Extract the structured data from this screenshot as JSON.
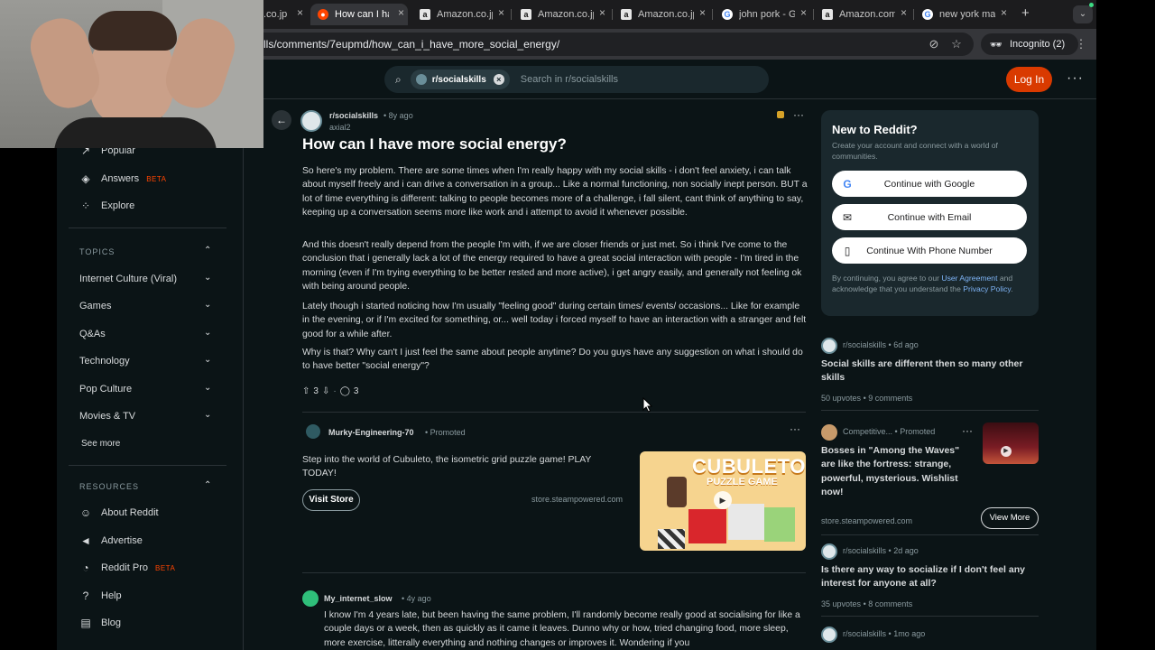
{
  "tabs": [
    {
      "title": ".co.jp",
      "favicon": "amazon",
      "active": false
    },
    {
      "title": "How can I ha",
      "favicon": "reddit",
      "active": true
    },
    {
      "title": "Amazon.co.jp",
      "favicon": "amazon",
      "active": false
    },
    {
      "title": "Amazon.co.jp",
      "favicon": "amazon",
      "active": false
    },
    {
      "title": "Amazon.co.jp",
      "favicon": "amazon",
      "active": false
    },
    {
      "title": "john pork - G",
      "favicon": "google",
      "active": false
    },
    {
      "title": "Amazon.com",
      "favicon": "amazon",
      "active": false
    },
    {
      "title": "new york ma",
      "favicon": "google",
      "active": false
    }
  ],
  "tab_close_glyph": "×",
  "new_tab_glyph": "+",
  "url": "lls/comments/7eupmd/how_can_i_have_more_social_energy/",
  "incognito_label": "Incognito (2)",
  "header": {
    "subreddit_chip": "r/socialskills",
    "search_placeholder": "Search in r/socialskills",
    "login_label": "Log In"
  },
  "sidebar": {
    "items_top": [
      {
        "label": "Popular",
        "icon": "trending-icon"
      },
      {
        "label": "Answers",
        "icon": "answers-icon",
        "badge": "BETA"
      },
      {
        "label": "Explore",
        "icon": "explore-icon"
      }
    ],
    "topics_heading": "TOPICS",
    "topics": [
      "Internet Culture (Viral)",
      "Games",
      "Q&As",
      "Technology",
      "Pop Culture",
      "Movies & TV"
    ],
    "see_more": "See more",
    "resources_heading": "RESOURCES",
    "resources": [
      {
        "label": "About Reddit",
        "icon": "reddit-alien-icon"
      },
      {
        "label": "Advertise",
        "icon": "megaphone-icon"
      },
      {
        "label": "Reddit Pro",
        "icon": "pro-icon",
        "badge": "BETA"
      },
      {
        "label": "Help",
        "icon": "help-icon"
      },
      {
        "label": "Blog",
        "icon": "book-icon"
      }
    ]
  },
  "post": {
    "subreddit": "r/socialskills",
    "age": "8y ago",
    "author": "axial2",
    "title": "How can I have more social energy?",
    "paragraphs": [
      "So here's my problem. There are some times when I'm really happy with my social skills - i don't feel anxiety, i can talk about myself freely and i can drive a conversation in a group... Like a normal functioning, non socially inept person. BUT a lot of time everything is different: talking to people becomes more of a challenge, i fall silent, cant think of anything to say, keeping up a conversation seems more like work and i attempt to avoid it whenever possible.",
      "And this doesn't really depend from the people I'm with, if we are closer friends or just met. So i think I've come to the conclusion that i generally lack a lot of the energy required to have a great social interaction with people - I'm tired in the morning (even if I'm trying everything to be better rested and more active), i get angry easily, and generally not feeling ok with being around people.",
      "Lately though i started noticing how I'm usually \"feeling good\" during certain times/ events/ occasions... Like for example in the evening, or if I'm excited for something, or... well today i forced myself to have an interaction with a stranger and felt good for a while after.",
      "Why is that? Why can't I just feel the same about people anytime? Do you guys have any suggestion on what i should do to have better \"social energy\"?"
    ],
    "score": "3",
    "comments": "3"
  },
  "ad": {
    "user": "Murky-Engineering-70",
    "promoted": "Promoted",
    "text": "Step into the world of Cubuleto, the isometric grid puzzle game! PLAY TODAY!",
    "button": "Visit Store",
    "domain": "store.steampowered.com",
    "image_title": "CUBULETO",
    "image_subtitle": "PUZZLE GAME"
  },
  "comment": {
    "user": "My_internet_slow",
    "age": "4y ago",
    "text": "I know I'm 4 years late, but been having the same problem, I'll randomly become really good at socialising for like a couple days or a week, then as quickly as it came it leaves. Dunno why or how, tried changing food, more sleep, more exercise, litterally everything and nothing changes or improves it. Wondering if you"
  },
  "rail": {
    "new_title": "New to Reddit?",
    "new_sub": "Create your account and connect with a world of communities.",
    "btn_google": "Continue with Google",
    "btn_email": "Continue with Email",
    "btn_phone": "Continue With Phone Number",
    "legal_pre": "By continuing, you agree to our ",
    "legal_ua": "User Agreement",
    "legal_mid": " and acknowledge that you understand the ",
    "legal_pp": "Privacy Policy",
    "legal_end": ".",
    "posts": [
      {
        "sub": "r/socialskills",
        "age": "6d ago",
        "title": "Social skills are different then so many other skills",
        "upvotes": "50 upvotes",
        "comments": "9 comments"
      },
      {
        "sub": "r/socialskills",
        "age": "2d ago",
        "title": "Is there any way to socialize if I don't feel any interest for anyone at all?",
        "upvotes": "35 upvotes",
        "comments": "8 comments"
      },
      {
        "sub": "r/socialskills",
        "age": "1mo ago"
      }
    ],
    "promo": {
      "user": "Competitive...",
      "promoted": "Promoted",
      "title": "Bosses in \"Among the Waves\" are like the fortress: strange, powerful, mysterious. Wishlist now!",
      "domain": "store.steampowered.com",
      "button": "View More"
    }
  },
  "dot_sep": "•",
  "colors": {
    "brand": "#ff4500",
    "login": "#d93a00",
    "link": "#7eb3f5"
  }
}
